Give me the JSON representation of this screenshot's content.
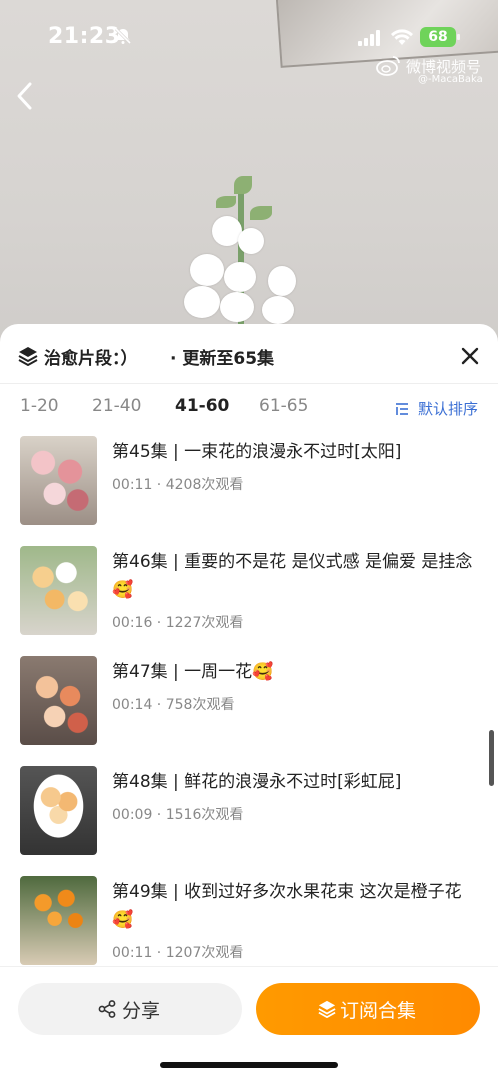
{
  "status_bar": {
    "time": "21:23",
    "battery": "68"
  },
  "watermark": {
    "title": "微博视频号",
    "user": "@-MacaBaka"
  },
  "sheet": {
    "title": "治愈片段：）",
    "update": "· 更新至65集"
  },
  "range_tabs": [
    {
      "label": "1-20",
      "active": false
    },
    {
      "label": "21-40",
      "active": false
    },
    {
      "label": "41-60",
      "active": true
    },
    {
      "label": "61-65",
      "active": false
    }
  ],
  "sort_label": "默认排序",
  "episodes": [
    {
      "title": "第45集 | 一束花的浪漫永不过时[太阳]",
      "duration": "00:11",
      "views": "4208次观看",
      "thumb_color": "#c98a8f"
    },
    {
      "title": "第46集 | 重要的不是花 是仪式感 是偏爱 是挂念🥰",
      "duration": "00:16",
      "views": "1227次观看",
      "thumb_color": "#f0c685"
    },
    {
      "title": "第47集 | 一周一花🥰",
      "duration": "00:14",
      "views": "758次观看",
      "thumb_color": "#e6a073"
    },
    {
      "title": "第48集 | 鲜花的浪漫永不过时[彩虹屁]",
      "duration": "00:09",
      "views": "1516次观看",
      "thumb_color": "#f2c690"
    },
    {
      "title": "第49集 | 收到过好多次水果花束 这次是橙子花🥰",
      "duration": "00:11",
      "views": "1207次观看",
      "thumb_color": "#f0932a"
    }
  ],
  "actions": {
    "share": "分享",
    "subscribe": "订阅合集"
  },
  "colors": {
    "accent": "#ff9000",
    "link": "#3b6fd4"
  }
}
